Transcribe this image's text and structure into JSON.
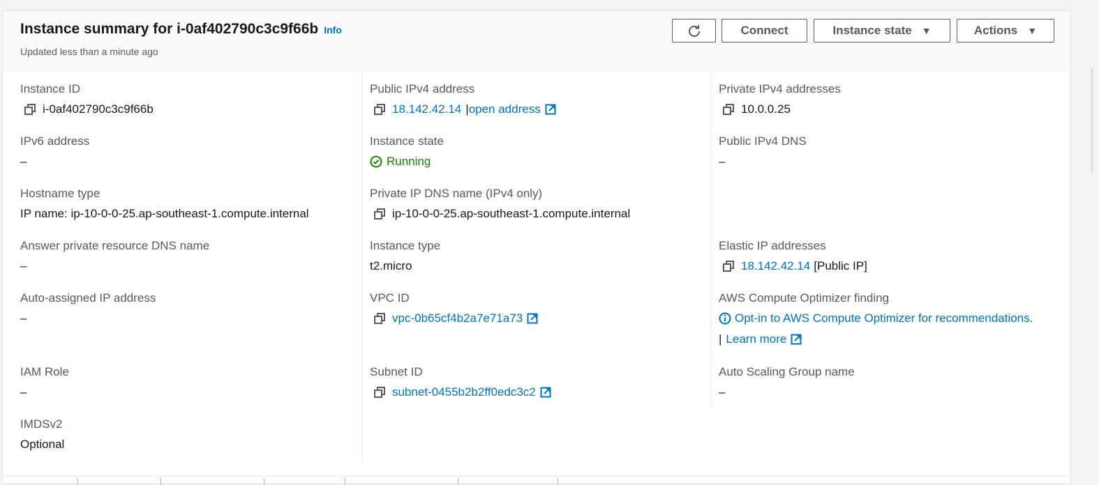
{
  "header": {
    "title": "Instance summary for i-0af402790c3c9f66b",
    "info": "Info",
    "updated": "Updated less than a minute ago",
    "buttons": {
      "connect": "Connect",
      "instance_state": "Instance state",
      "actions": "Actions"
    }
  },
  "fields": {
    "instance_id": {
      "label": "Instance ID",
      "value": "i-0af402790c3c9f66b"
    },
    "ipv6": {
      "label": "IPv6 address",
      "value": "–"
    },
    "hostname_type": {
      "label": "Hostname type",
      "value": "IP name: ip-10-0-0-25.ap-southeast-1.compute.internal"
    },
    "answer_dns": {
      "label": "Answer private resource DNS name",
      "value": "–"
    },
    "auto_ip": {
      "label": "Auto-assigned IP address",
      "value": "–"
    },
    "iam_role": {
      "label": "IAM Role",
      "value": "–"
    },
    "imdsv2": {
      "label": "IMDSv2",
      "value": "Optional"
    },
    "public_ipv4": {
      "label": "Public IPv4 address",
      "value": "18.142.42.14",
      "sep": "|",
      "open": "open address"
    },
    "instance_state": {
      "label": "Instance state",
      "value": "Running"
    },
    "private_dns": {
      "label": "Private IP DNS name (IPv4 only)",
      "value": "ip-10-0-0-25.ap-southeast-1.compute.internal"
    },
    "instance_type": {
      "label": "Instance type",
      "value": "t2.micro"
    },
    "vpc_id": {
      "label": "VPC ID",
      "value": "vpc-0b65cf4b2a7e71a73"
    },
    "subnet_id": {
      "label": "Subnet ID",
      "value": "subnet-0455b2b2ff0edc3c2"
    },
    "private_ipv4": {
      "label": "Private IPv4 addresses",
      "value": "10.0.0.25"
    },
    "public_dns": {
      "label": "Public IPv4 DNS",
      "value": "–"
    },
    "elastic_ip": {
      "label": "Elastic IP addresses",
      "value": "18.142.42.14",
      "suffix": "[Public IP]"
    },
    "optimizer": {
      "label": "AWS Compute Optimizer finding",
      "value": "Opt-in to AWS Compute Optimizer for recommendations.",
      "sep": "|",
      "learn": "Learn more"
    },
    "asg": {
      "label": "Auto Scaling Group name",
      "value": "–"
    }
  },
  "colors": {
    "link": "#0073bb",
    "success": "#1d8102",
    "text": "#16191f",
    "label": "#545b64"
  }
}
